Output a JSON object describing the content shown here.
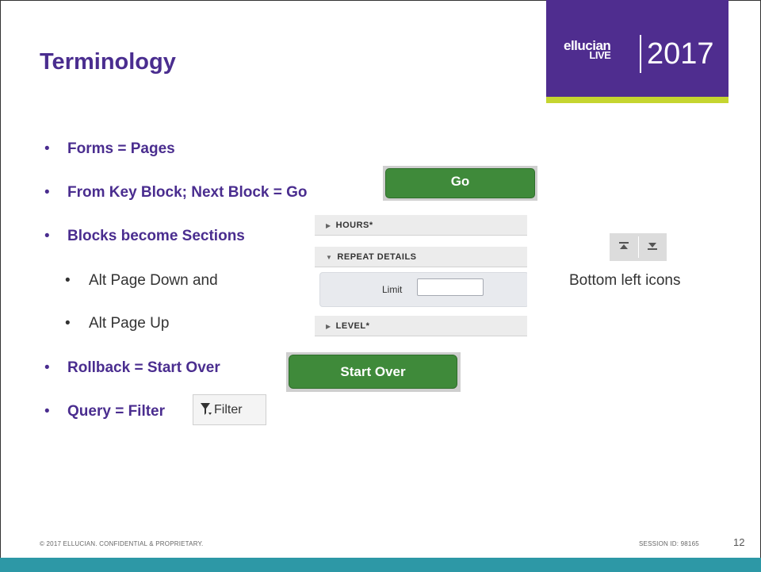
{
  "slide": {
    "title": "Terminology",
    "logo": {
      "brand_top": "ellucian",
      "brand_bottom": "LIVE",
      "year": "2017",
      "colors": {
        "box": "#4f2d8f",
        "stripe": "#c5d530"
      }
    },
    "bullets": [
      {
        "marker": "•",
        "text": "Forms = Pages"
      },
      {
        "marker": "•",
        "text": "From Key Block; Next Block = Go"
      },
      {
        "marker": "•",
        "text": "Blocks become Sections"
      },
      {
        "marker": "•",
        "text": "Rollback = Start Over"
      },
      {
        "marker": "•",
        "text": "Query = Filter"
      }
    ],
    "sub_bullets": [
      {
        "marker": "•",
        "text": "Alt Page Down and"
      },
      {
        "marker": "•",
        "text": "Alt Page Up"
      }
    ],
    "go_button": {
      "label": "Go"
    },
    "start_over_button": {
      "label": "Start Over"
    },
    "filter_button": {
      "label": "Filter",
      "icon": "filter-icon"
    },
    "sections_panel": {
      "headers": [
        {
          "label": "HOURS",
          "required": "*",
          "state": "collapsed"
        },
        {
          "label": "REPEAT DETAILS",
          "required": "",
          "state": "expanded"
        },
        {
          "label": "LEVEL",
          "required": "*",
          "state": "collapsed"
        }
      ],
      "field_label": "Limit",
      "field_value": ""
    },
    "nav_icons": [
      "jump-to-top-icon",
      "jump-to-bottom-icon"
    ],
    "bottom_icons_label": "Bottom left icons",
    "footer": {
      "copyright": "© 2017 ELLUCIAN. CONFIDENTIAL & PROPRIETARY.",
      "session": "SESSION ID: 98165",
      "page_number": "12"
    },
    "colors": {
      "title": "#4a2d8f",
      "button_green": "#3f8a3a",
      "footer_bar": "#2d98a6"
    }
  }
}
